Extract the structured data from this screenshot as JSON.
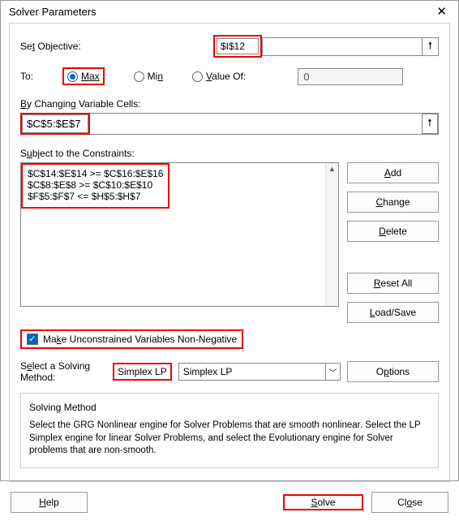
{
  "title": "Solver Parameters",
  "setObjective": {
    "label": "Set Objective:",
    "value": "$I$12"
  },
  "to": {
    "label": "To:",
    "max": "Max",
    "min": "Min",
    "valueOf": "Value Of:",
    "valueOfInput": "0",
    "selected": "max"
  },
  "changing": {
    "label": "By Changing Variable Cells:",
    "value": "$C$5:$E$7"
  },
  "constraints": {
    "label": "Subject to the Constraints:",
    "lines": [
      "$C$14:$E$14 >= $C$16:$E$16",
      "$C$8:$E$8 >= $C$10:$E$10",
      "$F$5:$F$7 <= $H$5:$H$7"
    ]
  },
  "sideButtons": {
    "add": "Add",
    "change": "Change",
    "delete": "Delete",
    "resetAll": "Reset All",
    "loadSave": "Load/Save"
  },
  "nonNeg": {
    "label": "Make Unconstrained Variables Non-Negative",
    "checked": true
  },
  "method": {
    "label": "Select a Solving Method:",
    "value": "Simplex LP",
    "options": "Options"
  },
  "info": {
    "title": "Solving Method",
    "text": "Select the GRG Nonlinear engine for Solver Problems that are smooth nonlinear. Select the LP Simplex engine for linear Solver Problems, and select the Evolutionary engine for Solver problems that are non-smooth."
  },
  "footer": {
    "help": "Help",
    "solve": "Solve",
    "close": "Close"
  }
}
